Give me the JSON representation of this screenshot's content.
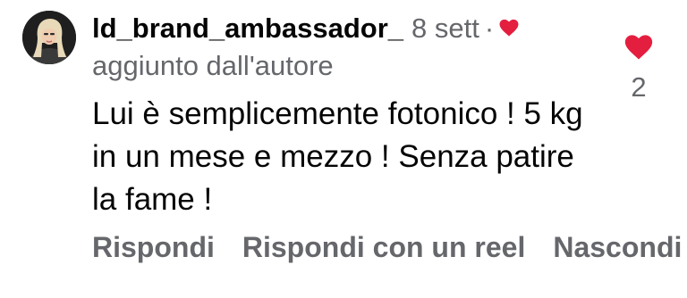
{
  "comment": {
    "username": "ld_brand_ambassador_",
    "time": "8 sett",
    "separator": "·",
    "subtitle": "aggiunto dall'autore",
    "text": "Lui è semplicemente fotonico ! 5 kg in un mese e mezzo ! Senza patire la fame !",
    "like_count": "2",
    "author_liked": true,
    "liked": true,
    "icons": {
      "author_like": "heart-icon",
      "like": "heart-icon"
    },
    "colors": {
      "heart": "#e41e3f",
      "secondary_text": "#65676b",
      "primary_text": "#050505"
    }
  },
  "actions": {
    "reply": "Rispondi",
    "reply_reel": "Rispondi con un reel",
    "hide": "Nascondi"
  }
}
